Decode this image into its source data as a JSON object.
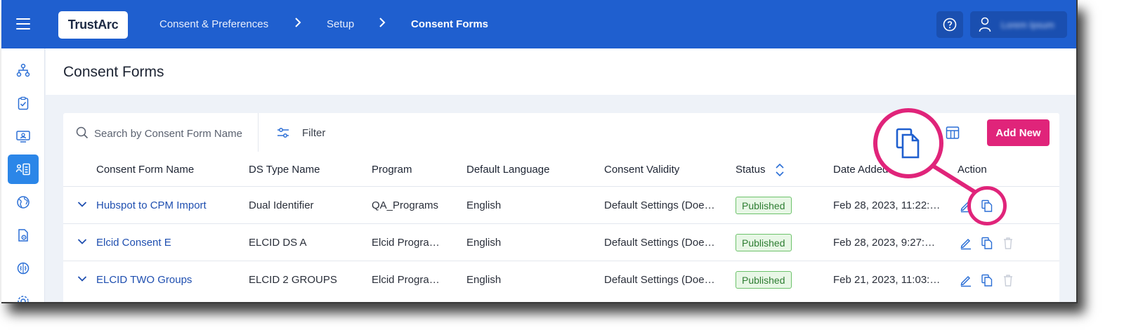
{
  "app": {
    "logo_text": "TrustArc",
    "breadcrumb": [
      "Consent & Preferences",
      "Setup",
      "Consent Forms"
    ],
    "user_name": "Lorem Ipsum"
  },
  "page": {
    "title": "Consent Forms"
  },
  "toolbar": {
    "search_placeholder": "Search by Consent Form Name",
    "filter_label": "Filter",
    "add_new_label": "Add New"
  },
  "table": {
    "headers": [
      "Consent Form Name",
      "DS Type Name",
      "Program",
      "Default Language",
      "Consent Validity",
      "Status",
      "Date Added",
      "Action"
    ],
    "rows": [
      {
        "name": "Hubspot to CPM Import",
        "ds_type": "Dual Identifier",
        "program": "QA_Programs",
        "language": "English",
        "validity": "Default Settings (Doe…",
        "status": "Published",
        "date": "Feb 28, 2023, 11:22:…"
      },
      {
        "name": "Elcid Consent E",
        "ds_type": "ELCID DS A",
        "program": "Elcid Progra…",
        "language": "English",
        "validity": "Default Settings (Doe…",
        "status": "Published",
        "date": "Feb 28, 2023, 9:27:…"
      },
      {
        "name": "ELCID TWO Groups",
        "ds_type": "ELCID 2 GROUPS",
        "program": "Elcid Progra…",
        "language": "English",
        "validity": "Default Settings (Doe…",
        "status": "Published",
        "date": "Feb 21, 2023, 11:03:…"
      }
    ]
  },
  "colors": {
    "header_blue": "#1f5fcf",
    "accent_pink": "#e0247a",
    "badge_green": "#6cc26a"
  },
  "icons": {
    "sidebar": [
      "hierarchy-icon",
      "clipboard-check-icon",
      "monitor-user-icon",
      "consent-form-icon",
      "globe-icon",
      "document-settings-icon",
      "brain-icon",
      "settings-icon"
    ],
    "actions": [
      "edit-icon",
      "copy-icon",
      "delete-icon"
    ]
  }
}
